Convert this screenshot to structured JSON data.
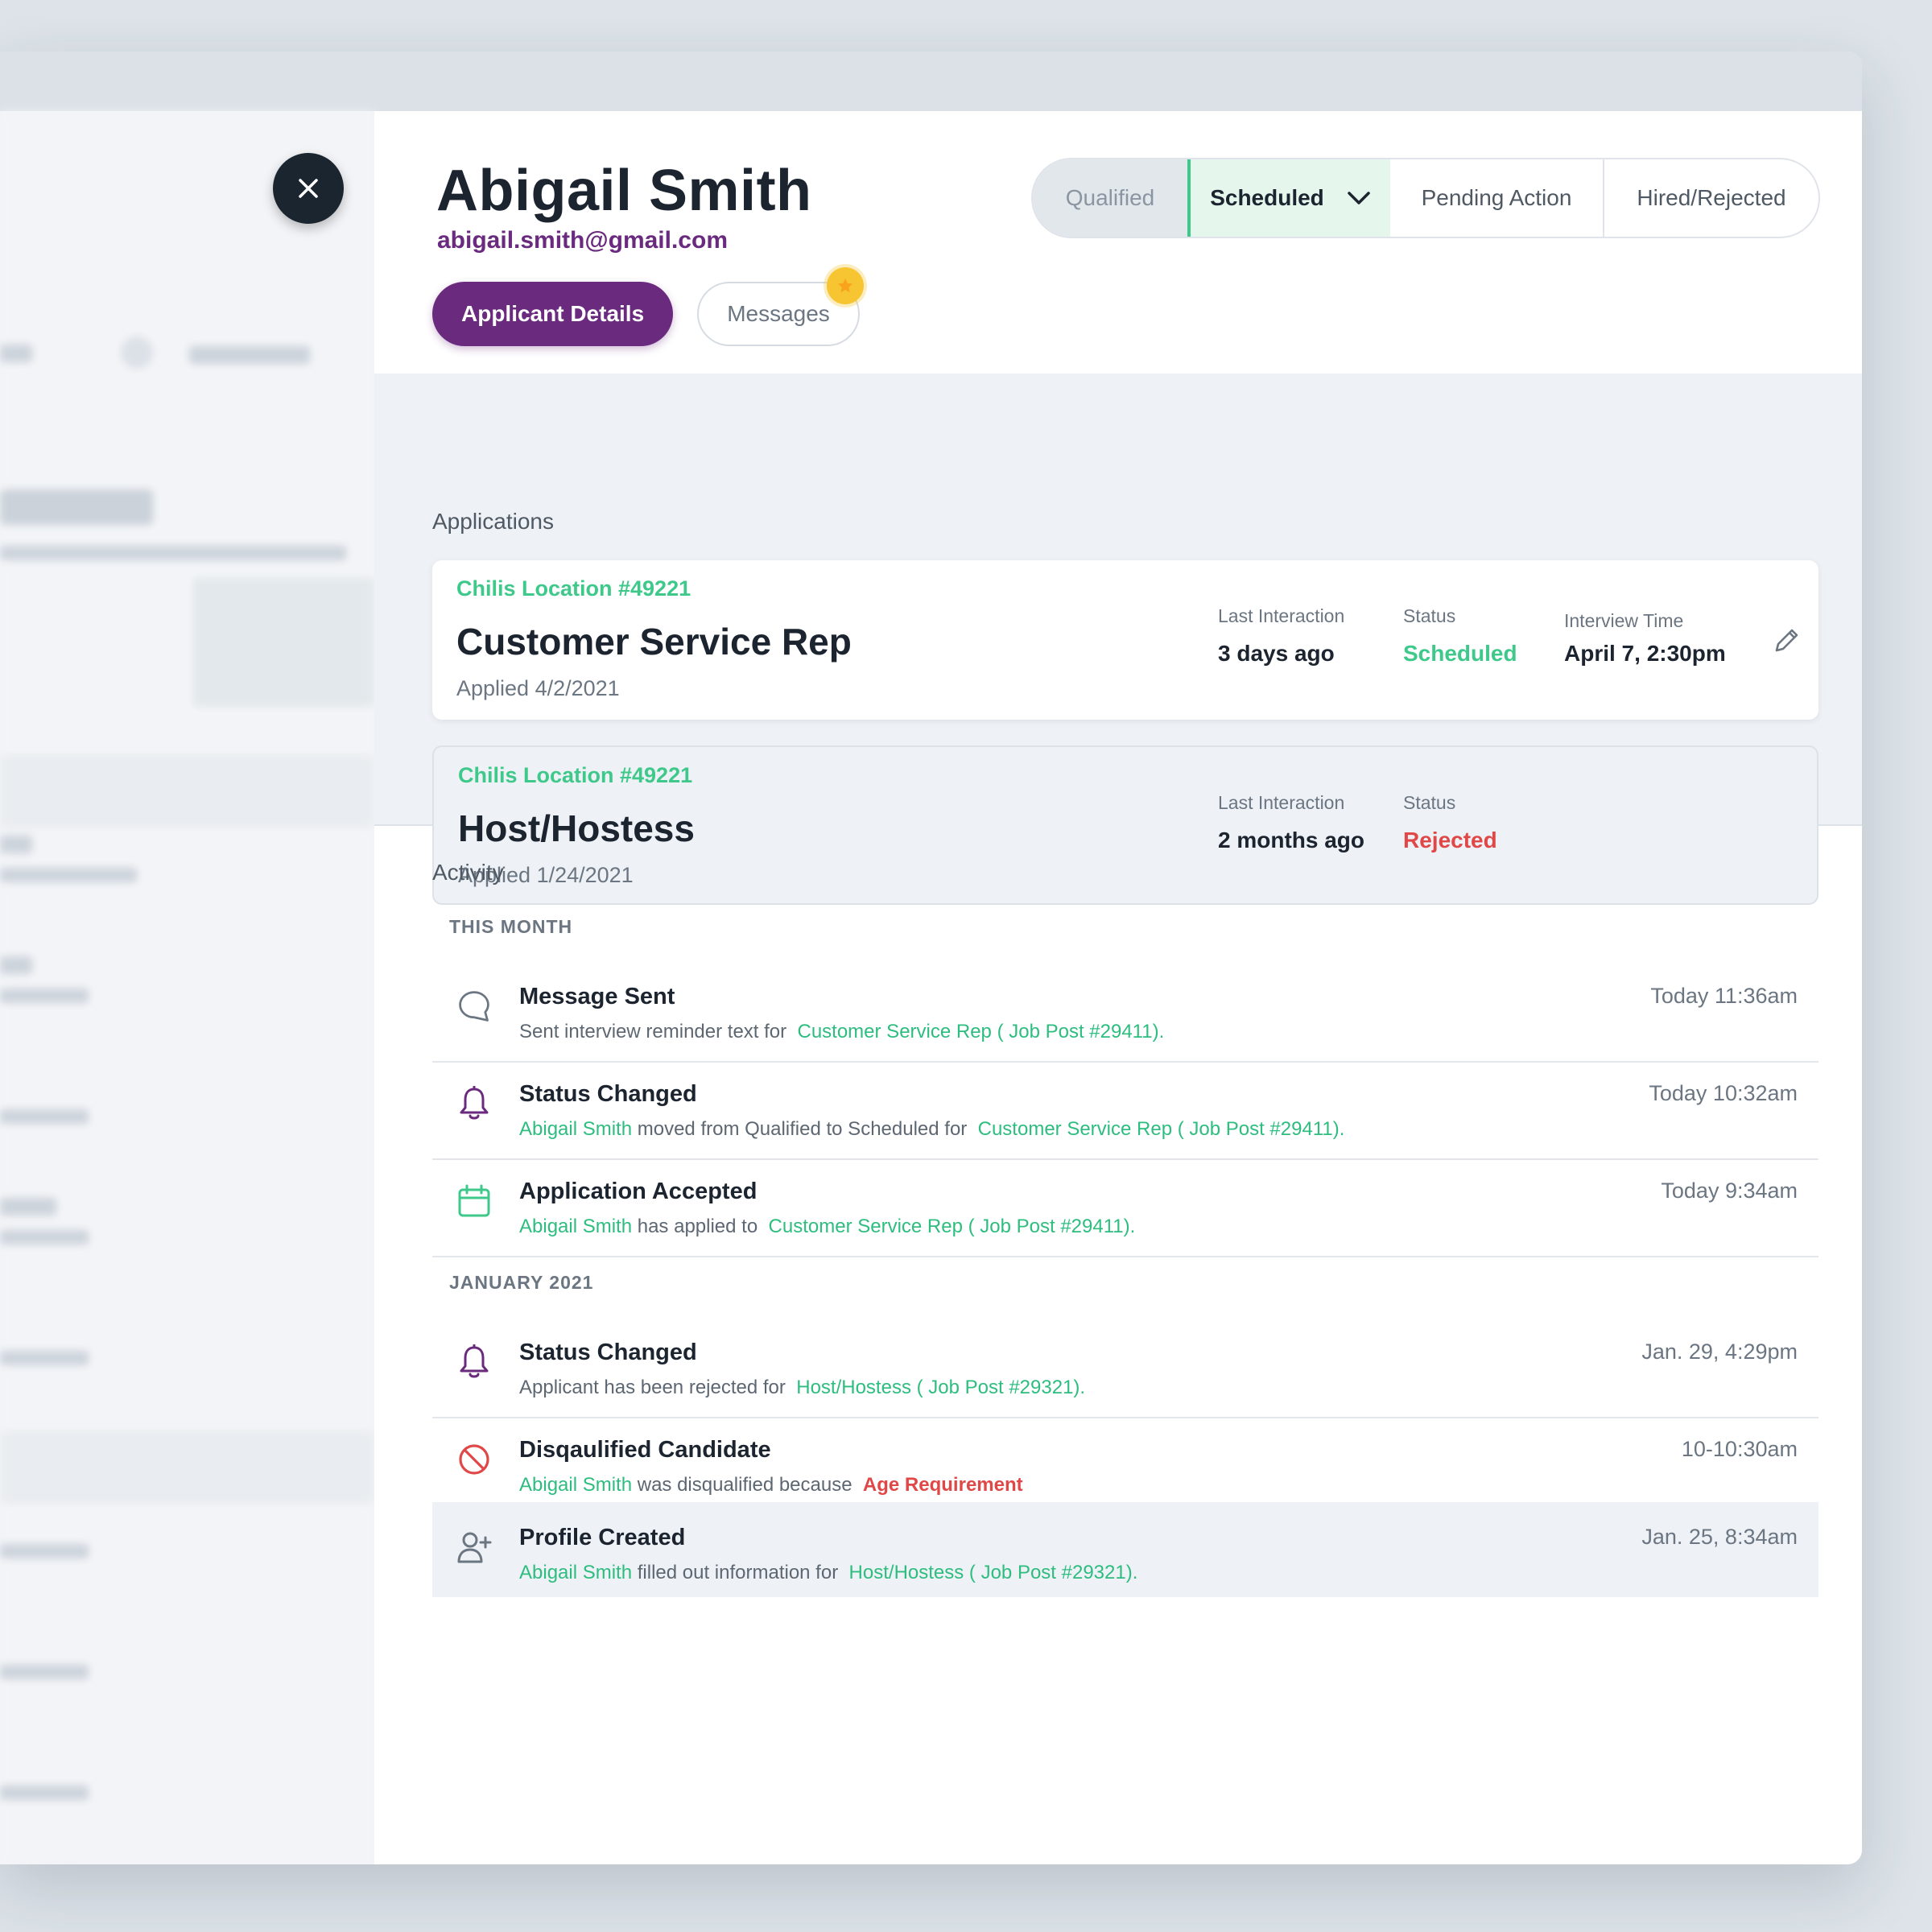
{
  "applicant": {
    "name": "Abigail Smith",
    "email": "abigail.smith@gmail.com"
  },
  "tabs": {
    "details": "Applicant Details",
    "messages": "Messages"
  },
  "status_bar": {
    "qualified": "Qualified",
    "scheduled": "Scheduled",
    "pending": "Pending Action",
    "hired": "Hired/Rejected",
    "active": "Scheduled"
  },
  "applications": {
    "label": "Applications",
    "items": [
      {
        "location": "Chilis Location #49221",
        "title": "Customer Service Rep",
        "applied": "Applied 4/2/2021",
        "last_interaction_label": "Last Interaction",
        "last_interaction": "3 days ago",
        "status_label": "Status",
        "status": "Scheduled",
        "interview_label": "Interview Time",
        "interview_time": "April 7, 2:30pm"
      },
      {
        "location": "Chilis Location #49221",
        "title": "Host/Hostess",
        "applied": "Applied 1/24/2021",
        "last_interaction_label": "Last Interaction",
        "last_interaction": "2 months ago",
        "status_label": "Status",
        "status": "Rejected"
      }
    ]
  },
  "activity": {
    "label": "Activity",
    "groups": [
      {
        "month": "THIS MONTH",
        "items": [
          {
            "icon": "chat-bubble-icon",
            "title": "Message Sent",
            "time": "Today 11:36am",
            "desc_1": "Sent interview reminder text for",
            "link_1": "Customer Service Rep ( Job Post #29411)."
          },
          {
            "icon": "bell-icon",
            "title": "Status Changed",
            "time": "Today 10:32am",
            "name": "Abigail Smith",
            "desc_1": "moved from Qualified to Scheduled for",
            "link_1": "Customer Service Rep ( Job Post #29411)."
          },
          {
            "icon": "calendar-icon",
            "title": "Application Accepted",
            "time": "Today 9:34am",
            "name": "Abigail Smith",
            "desc_1": "has applied to",
            "link_1": "Customer Service Rep ( Job Post #29411)."
          }
        ]
      },
      {
        "month": "JANUARY 2021",
        "items": [
          {
            "icon": "bell-icon",
            "title": "Status Changed",
            "time": "Jan. 29, 4:29pm",
            "desc_1": "Applicant has been rejected for",
            "link_1": "Host/Hostess ( Job Post #29321)."
          },
          {
            "icon": "prohibited-icon",
            "title": "Disqaulified Candidate",
            "time": "10-10:30am",
            "name": "Abigail Smith",
            "desc_1": "was disqualified because",
            "reason": "Age Requirement"
          },
          {
            "icon": "add-user-icon",
            "title": "Profile Created",
            "time": "Jan. 25, 8:34am",
            "name": "Abigail Smith",
            "desc_1": "filled out information for",
            "link_1": "Host/Hostess ( Job Post #29321)."
          }
        ]
      }
    ]
  },
  "colors": {
    "brand_purple": "#6a2a7e",
    "accent_green": "#3ec98b",
    "reject_red": "#e04848",
    "badge_yellow": "#f6c531"
  }
}
